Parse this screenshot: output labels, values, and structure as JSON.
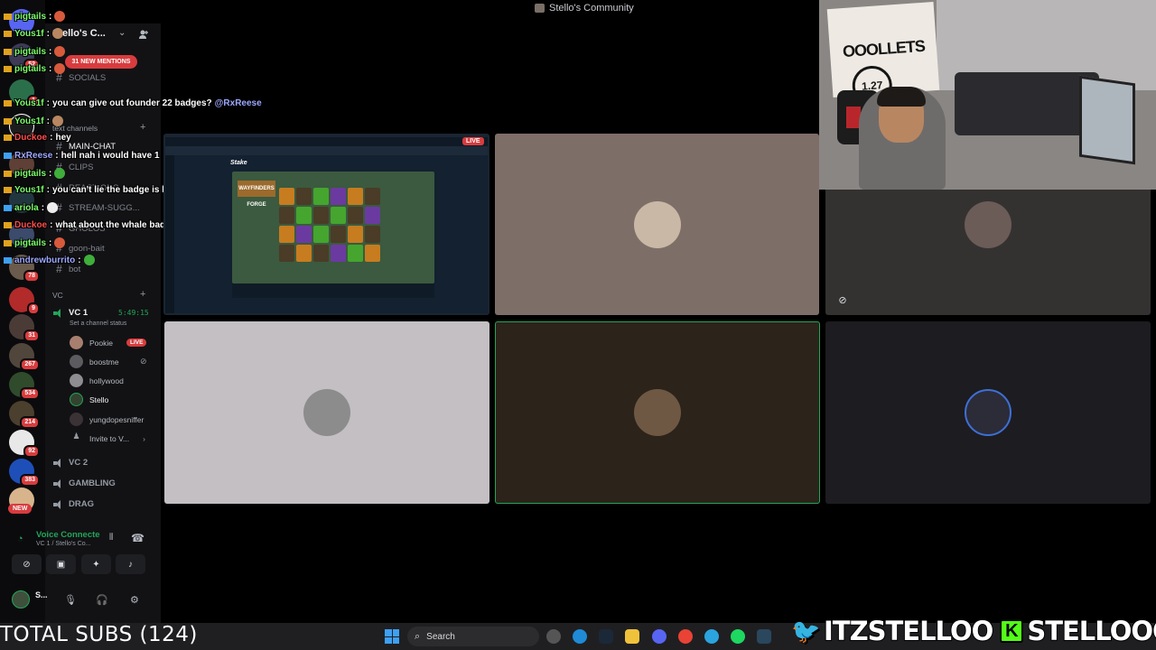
{
  "window": {
    "title": "Stello's Community"
  },
  "server": {
    "name": "Stello's C...",
    "mentions": "31 NEW MENTIONS",
    "channels": [
      {
        "name": "SOCIALS"
      },
      {
        "name": "MAIN-CHAT"
      },
      {
        "name": "CLIPS"
      },
      {
        "name": "REACTIONS"
      },
      {
        "name": "STREAM-SUGG..."
      },
      {
        "name": "GHOLOS"
      },
      {
        "name": "goon-bait"
      },
      {
        "name": "bot"
      }
    ],
    "categories": {
      "text": "text channels",
      "vc": "VC"
    }
  },
  "rail": {
    "badges": [
      "52",
      "1",
      "78",
      "9",
      "31",
      "267",
      "534",
      "214",
      "92",
      "383"
    ],
    "new_label": "NEW"
  },
  "voice": {
    "channel": "VC 1",
    "timer": "5:49:15",
    "status": "Set a channel status",
    "members": [
      {
        "name": "Pookie",
        "live": "LIVE"
      },
      {
        "name": "boostme"
      },
      {
        "name": "hollywood"
      },
      {
        "name": "Stello"
      },
      {
        "name": "yungdopesniffer"
      }
    ],
    "invite": "Invite to V...",
    "other_channels": [
      "VC 2",
      "GAMBLING",
      "DRAG"
    ]
  },
  "voice_panel": {
    "title": "Voice Connecte",
    "subtitle": "VC 1 / Stello's Co...",
    "user": "S..."
  },
  "chat": [
    {
      "user": "pigtails",
      "color": "#7cfc6c",
      "text": ""
    },
    {
      "user": "Yous1f",
      "color": "#7cfc6c",
      "text": ""
    },
    {
      "user": "pigtails",
      "color": "#7cfc6c",
      "text": ""
    },
    {
      "user": "pigtails",
      "color": "#7cfc6c",
      "text": ""
    },
    {
      "user": "Yous1f",
      "color": "#7cfc6c",
      "text": "you can give out founder 22 badges?",
      "mention": "@RxReese"
    },
    {
      "user": "Yous1f",
      "color": "#7cfc6c",
      "text": ""
    },
    {
      "user": "Duckoe",
      "color": "#ff4d4d",
      "text": "hey"
    },
    {
      "user": "RxReese",
      "color": "#9ea8ff",
      "text": "hell nah i would have 1"
    },
    {
      "user": "pigtails",
      "color": "#7cfc6c",
      "text": ""
    },
    {
      "user": "Yous1f",
      "color": "#7cfc6c",
      "text": "you can't lie the badge is hard"
    },
    {
      "user": "ariola",
      "color": "#7cfc6c",
      "text": ""
    },
    {
      "user": "Duckoe",
      "color": "#ff4d4d",
      "text": "what about the whale badge"
    },
    {
      "user": "pigtails",
      "color": "#7cfc6c",
      "text": ""
    },
    {
      "user": "andrewburrito",
      "color": "#9ea8ff",
      "text": ""
    }
  ],
  "stream": {
    "live_label": "LIVE",
    "site": "Stake",
    "game": "WAYFINDERS FORGE"
  },
  "webcam": {
    "board_text": "OOOLLETS",
    "board_badge": "1.27"
  },
  "taskbar": {
    "subs": "TOTAL SUBS (124)",
    "search_placeholder": "Search"
  },
  "social": {
    "twitter_handle": "ITZSTELLOO",
    "kick_handle": "STELLOOO",
    "kick_letter": "K"
  },
  "colors": {
    "accent_green": "#23a55a",
    "danger_red": "#d83c3e",
    "kick_green": "#53fc18",
    "twitter_blue": "#1d9bf0"
  }
}
